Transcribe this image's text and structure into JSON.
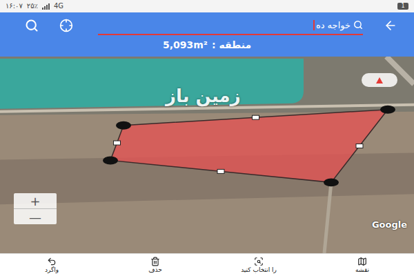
{
  "status_bar": {
    "time": "۱۶:۰۷",
    "battery": "۲۵٪",
    "network": "4G",
    "notification_count": "1"
  },
  "search": {
    "value": "خواجه ده"
  },
  "area": {
    "label": "منطقه :",
    "value": "5,093m²"
  },
  "map": {
    "watermark": "زمین باز",
    "attribution": "Google",
    "zoom_in": "+",
    "zoom_out": "—"
  },
  "toolbar": [
    {
      "label": "نقشه"
    },
    {
      "label": "را انتخاب کنید"
    },
    {
      "label": "حذف"
    },
    {
      "label": "واگرد"
    }
  ]
}
